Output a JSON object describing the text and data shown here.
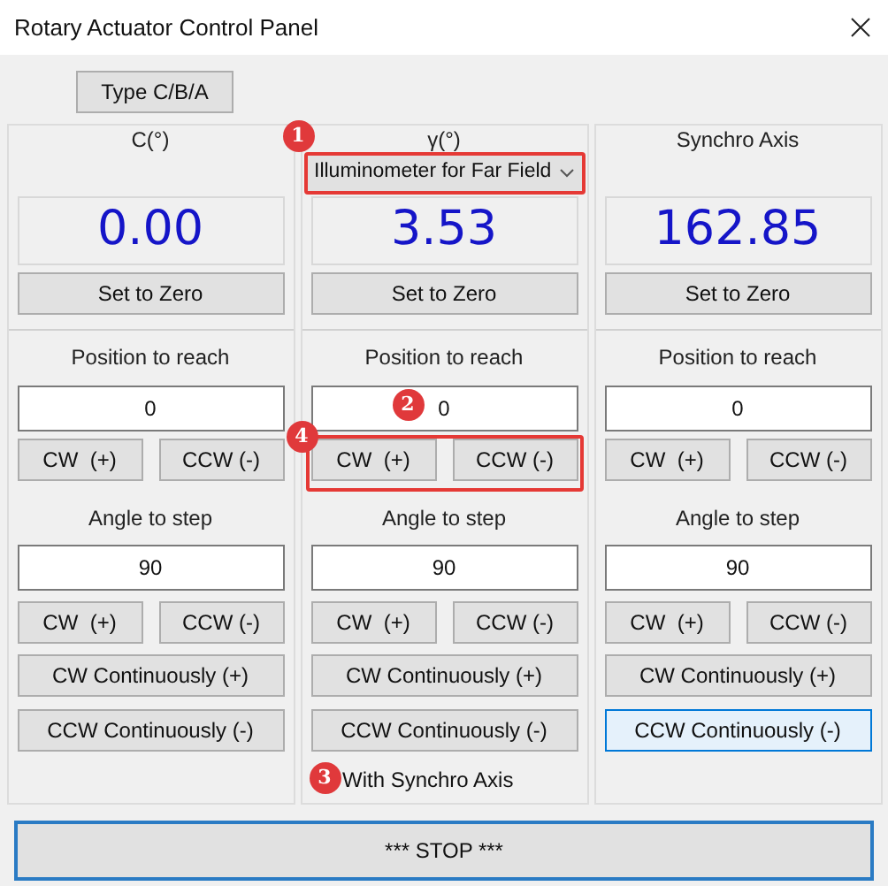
{
  "window": {
    "title": "Rotary Actuator Control Panel"
  },
  "type_button": "Type C/B/A",
  "columns": [
    {
      "header": "C(°)",
      "value": "0.00",
      "zero_button": "Set to Zero",
      "position_label": "Position to reach",
      "position_value": "0",
      "position_buttons": [
        "CW  (+)",
        "CCW (-)"
      ],
      "step_label": "Angle to step",
      "step_value": "90",
      "step_buttons": [
        "CW  (+)",
        "CCW (-)"
      ],
      "continuous_buttons": [
        {
          "label": "CW Continuously (+)",
          "focused": false
        },
        {
          "label": "CCW Continuously (-)",
          "focused": false
        }
      ]
    },
    {
      "header": "γ(°)",
      "dropdown": {
        "value": "Illuminometer for Far Field",
        "highlighted": true,
        "badge": "1"
      },
      "value": "3.53",
      "zero_button": "Set to Zero",
      "position_label": "Position to reach",
      "position_value": "0",
      "position_badge": "2",
      "position_buttons": [
        "CW  (+)",
        "CCW (-)"
      ],
      "position_buttons_highlighted": true,
      "position_buttons_badge": "4",
      "step_label": "Angle to step",
      "step_value": "90",
      "step_buttons": [
        "CW  (+)",
        "CCW (-)"
      ],
      "continuous_buttons": [
        {
          "label": "CW Continuously (+)",
          "focused": false
        },
        {
          "label": "CCW Continuously (-)",
          "focused": false
        }
      ],
      "checkbox": {
        "label": "With Synchro Axis",
        "badge": "3"
      }
    },
    {
      "header": "Synchro Axis",
      "value": "162.85",
      "zero_button": "Set to Zero",
      "position_label": "Position to reach",
      "position_value": "0",
      "position_buttons": [
        "CW  (+)",
        "CCW (-)"
      ],
      "step_label": "Angle to step",
      "step_value": "90",
      "step_buttons": [
        "CW  (+)",
        "CCW (-)"
      ],
      "continuous_buttons": [
        {
          "label": "CW Continuously (+)",
          "focused": false
        },
        {
          "label": "CCW Continuously (-)",
          "focused": true
        }
      ]
    }
  ],
  "stop_button": "*** STOP ***"
}
